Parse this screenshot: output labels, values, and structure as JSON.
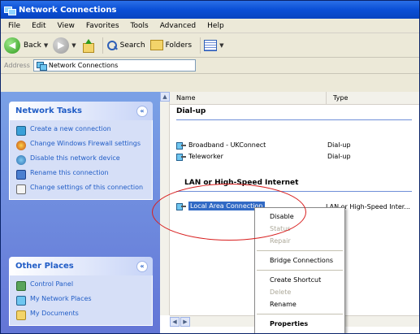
{
  "window": {
    "title": "Network Connections"
  },
  "menu": [
    "File",
    "Edit",
    "View",
    "Favorites",
    "Tools",
    "Advanced",
    "Help"
  ],
  "toolbar": {
    "back_label": "Back",
    "search_label": "Search",
    "folders_label": "Folders"
  },
  "address": {
    "label": "Address",
    "value": "Network Connections"
  },
  "task_pane": {
    "network_tasks": {
      "title": "Network Tasks",
      "items": [
        "Create a new connection",
        "Change Windows Firewall settings",
        "Disable this network device",
        "Rename this connection",
        "Change settings of this connection"
      ]
    },
    "other_places": {
      "title": "Other Places",
      "items": [
        "Control Panel",
        "My Network Places",
        "My Documents"
      ]
    }
  },
  "columns": {
    "name": "Name",
    "type": "Type"
  },
  "groups": {
    "dialup": {
      "title": "Dial-up",
      "items": [
        {
          "name": "Broadband - UKConnect",
          "type": "Dial-up"
        },
        {
          "name": "Teleworker",
          "type": "Dial-up"
        }
      ]
    },
    "lan": {
      "title": "LAN or High-Speed Internet",
      "items": [
        {
          "name": "Local Area Connection",
          "type": "LAN or High-Speed Inter..."
        }
      ]
    }
  },
  "context_menu": {
    "items": [
      "Disable",
      "Status",
      "Repair",
      "Bridge Connections",
      "Create Shortcut",
      "Delete",
      "Rename",
      "Properties"
    ]
  },
  "colors": {
    "title_bar": "#0a4fd6",
    "task_pane": "#6375d6",
    "selection": "#316ac5",
    "highlight_ellipse": "#d81e1e"
  },
  "icons": [
    "back-icon",
    "forward-icon",
    "up-folder-icon",
    "search-icon",
    "folders-icon",
    "views-icon",
    "network-connection-icon"
  ]
}
